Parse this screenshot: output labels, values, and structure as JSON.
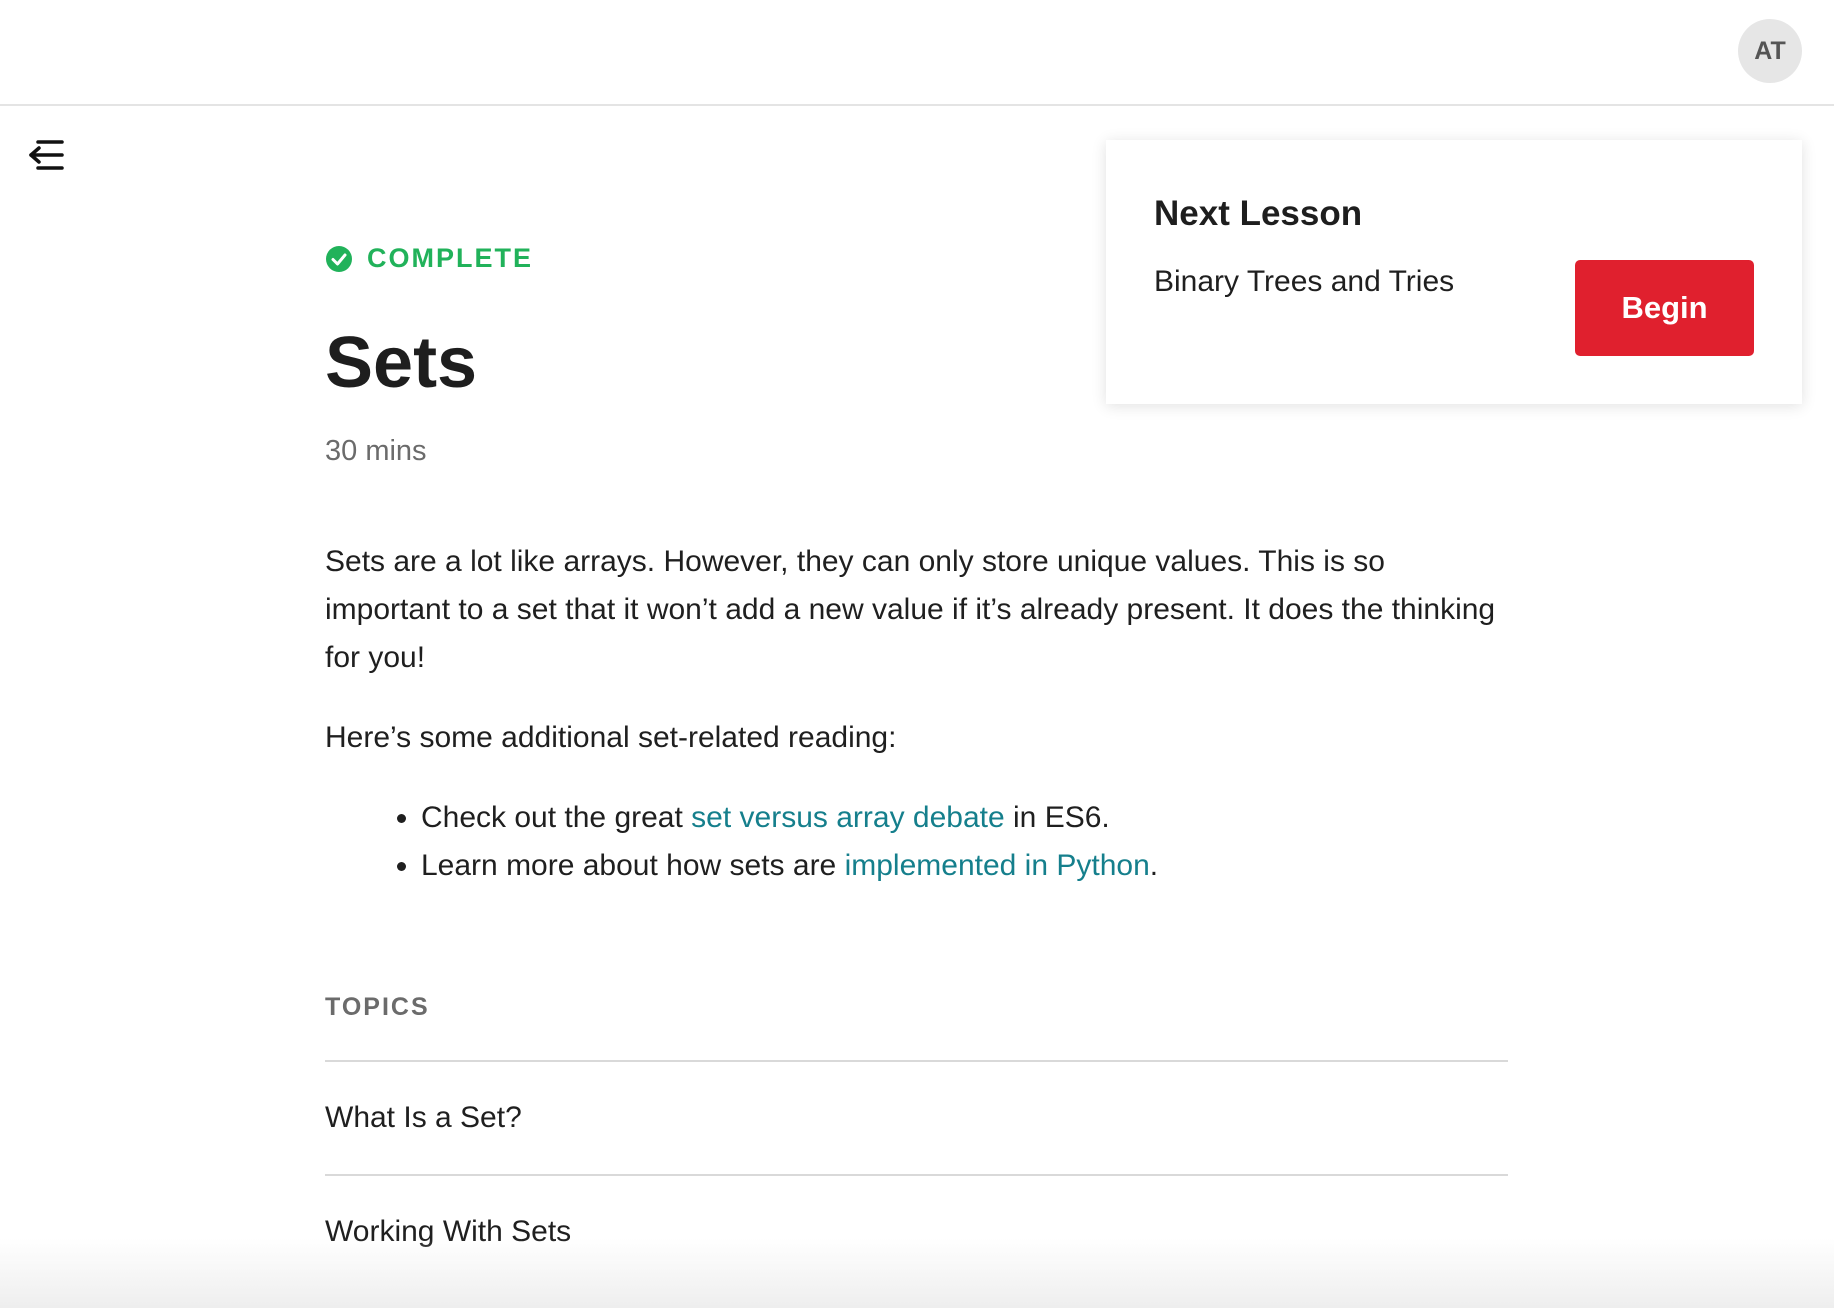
{
  "header": {
    "avatar_initials": "AT"
  },
  "lesson": {
    "status": "COMPLETE",
    "status_color": "#21b25a",
    "title": "Sets",
    "duration": "30 mins",
    "paragraph1": "Sets are a lot like arrays. However, they can only store unique values. This is so important to a set that it won’t add a new value if it’s already present. It does the thinking for you!",
    "paragraph2": "Here’s some additional set-related reading:",
    "bullets": [
      {
        "before": "Check out the great ",
        "link": "set versus array debate",
        "after": " in ES6."
      },
      {
        "before": "Learn more about how sets are ",
        "link": "implemented in Python",
        "after": "."
      }
    ]
  },
  "topics": {
    "heading": "TOPICS",
    "items": [
      "What Is a Set?",
      "Working With Sets"
    ]
  },
  "next_lesson": {
    "heading": "Next Lesson",
    "name": "Binary Trees and Tries",
    "button_label": "Begin",
    "button_color": "#e0202e"
  },
  "icons": {
    "menu": "collapse-menu-icon",
    "status": "check-circle-icon"
  },
  "colors": {
    "link": "#157f8c"
  }
}
